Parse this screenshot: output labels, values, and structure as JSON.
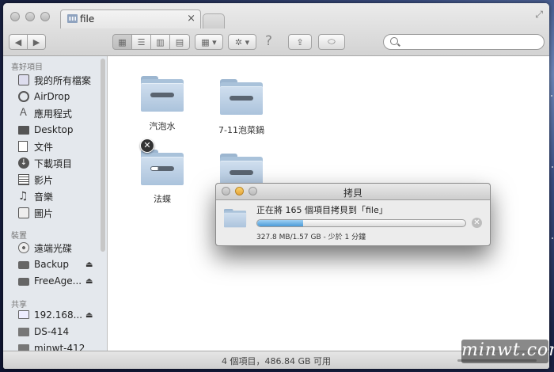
{
  "window": {
    "tab_title": "file",
    "tab_close": "×",
    "fullscreen_glyph": "⤢"
  },
  "toolbar": {
    "back_glyph": "◀",
    "forward_glyph": "▶",
    "view_icon_glyph": "▦",
    "view_list_glyph": "☰",
    "view_column_glyph": "▥",
    "view_coverflow_glyph": "▤",
    "arrange_glyph": "▦ ▾",
    "action_glyph": "✲ ▾",
    "help_glyph": "?",
    "share_glyph": "⇪",
    "tags_glyph": "⬭",
    "search_placeholder": ""
  },
  "sidebar": {
    "favorites_header": "喜好項目",
    "devices_header": "裝置",
    "shared_header": "共享",
    "favorites": [
      {
        "label": "我的所有檔案",
        "icon": "all-files-icon"
      },
      {
        "label": "AirDrop",
        "icon": "airdrop-icon"
      },
      {
        "label": "應用程式",
        "icon": "applications-icon"
      },
      {
        "label": "Desktop",
        "icon": "desktop-icon"
      },
      {
        "label": "文件",
        "icon": "documents-icon"
      },
      {
        "label": "下載項目",
        "icon": "downloads-icon"
      },
      {
        "label": "影片",
        "icon": "movies-icon"
      },
      {
        "label": "音樂",
        "icon": "music-icon"
      },
      {
        "label": "圖片",
        "icon": "pictures-icon"
      }
    ],
    "devices": [
      {
        "label": "遠端光碟",
        "icon": "remote-disc-icon",
        "eject": ""
      },
      {
        "label": "Backup",
        "icon": "external-drive-icon",
        "eject": "⏏"
      },
      {
        "label": "FreeAge...",
        "icon": "external-drive-icon",
        "eject": "⏏"
      }
    ],
    "shared": [
      {
        "label": "192.168...",
        "icon": "network-computer-icon",
        "eject": "⏏"
      },
      {
        "label": "DS-414",
        "icon": "network-server-icon",
        "eject": ""
      },
      {
        "label": "minwt-412",
        "icon": "network-server-icon",
        "eject": ""
      }
    ]
  },
  "content": {
    "items": [
      {
        "label": "汽泡水"
      },
      {
        "label": "7-11泡菜鍋"
      },
      {
        "label": "法蝶"
      },
      {
        "label": ""
      }
    ],
    "delete_badge": "✕"
  },
  "status": {
    "text": "4 個項目，486.84 GB 可用"
  },
  "copy_dialog": {
    "title": "拷貝",
    "message": "正在將 165 個項目拷貝到「file」",
    "progress": 0.22,
    "detail": "327.8 MB/1.57 GB - 少於 1 分鐘",
    "stop_glyph": "✕"
  },
  "watermark": {
    "text": "minwt.com"
  },
  "colors": {
    "folder": "#abc3dc",
    "progress": "#4a9ad8",
    "sidebar_bg": "#e4e8ed"
  }
}
